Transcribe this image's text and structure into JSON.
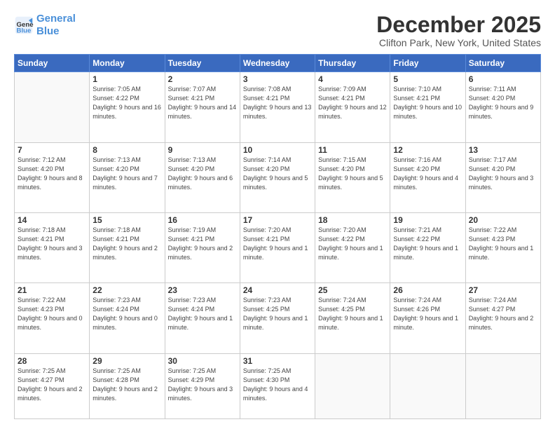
{
  "logo": {
    "line1": "General",
    "line2": "Blue"
  },
  "title": "December 2025",
  "location": "Clifton Park, New York, United States",
  "days_of_week": [
    "Sunday",
    "Monday",
    "Tuesday",
    "Wednesday",
    "Thursday",
    "Friday",
    "Saturday"
  ],
  "weeks": [
    [
      {
        "day": "",
        "sunrise": "",
        "sunset": "",
        "daylight": ""
      },
      {
        "day": "1",
        "sunrise": "Sunrise: 7:05 AM",
        "sunset": "Sunset: 4:22 PM",
        "daylight": "Daylight: 9 hours and 16 minutes."
      },
      {
        "day": "2",
        "sunrise": "Sunrise: 7:07 AM",
        "sunset": "Sunset: 4:21 PM",
        "daylight": "Daylight: 9 hours and 14 minutes."
      },
      {
        "day": "3",
        "sunrise": "Sunrise: 7:08 AM",
        "sunset": "Sunset: 4:21 PM",
        "daylight": "Daylight: 9 hours and 13 minutes."
      },
      {
        "day": "4",
        "sunrise": "Sunrise: 7:09 AM",
        "sunset": "Sunset: 4:21 PM",
        "daylight": "Daylight: 9 hours and 12 minutes."
      },
      {
        "day": "5",
        "sunrise": "Sunrise: 7:10 AM",
        "sunset": "Sunset: 4:21 PM",
        "daylight": "Daylight: 9 hours and 10 minutes."
      },
      {
        "day": "6",
        "sunrise": "Sunrise: 7:11 AM",
        "sunset": "Sunset: 4:20 PM",
        "daylight": "Daylight: 9 hours and 9 minutes."
      }
    ],
    [
      {
        "day": "7",
        "sunrise": "Sunrise: 7:12 AM",
        "sunset": "Sunset: 4:20 PM",
        "daylight": "Daylight: 9 hours and 8 minutes."
      },
      {
        "day": "8",
        "sunrise": "Sunrise: 7:13 AM",
        "sunset": "Sunset: 4:20 PM",
        "daylight": "Daylight: 9 hours and 7 minutes."
      },
      {
        "day": "9",
        "sunrise": "Sunrise: 7:13 AM",
        "sunset": "Sunset: 4:20 PM",
        "daylight": "Daylight: 9 hours and 6 minutes."
      },
      {
        "day": "10",
        "sunrise": "Sunrise: 7:14 AM",
        "sunset": "Sunset: 4:20 PM",
        "daylight": "Daylight: 9 hours and 5 minutes."
      },
      {
        "day": "11",
        "sunrise": "Sunrise: 7:15 AM",
        "sunset": "Sunset: 4:20 PM",
        "daylight": "Daylight: 9 hours and 5 minutes."
      },
      {
        "day": "12",
        "sunrise": "Sunrise: 7:16 AM",
        "sunset": "Sunset: 4:20 PM",
        "daylight": "Daylight: 9 hours and 4 minutes."
      },
      {
        "day": "13",
        "sunrise": "Sunrise: 7:17 AM",
        "sunset": "Sunset: 4:20 PM",
        "daylight": "Daylight: 9 hours and 3 minutes."
      }
    ],
    [
      {
        "day": "14",
        "sunrise": "Sunrise: 7:18 AM",
        "sunset": "Sunset: 4:21 PM",
        "daylight": "Daylight: 9 hours and 3 minutes."
      },
      {
        "day": "15",
        "sunrise": "Sunrise: 7:18 AM",
        "sunset": "Sunset: 4:21 PM",
        "daylight": "Daylight: 9 hours and 2 minutes."
      },
      {
        "day": "16",
        "sunrise": "Sunrise: 7:19 AM",
        "sunset": "Sunset: 4:21 PM",
        "daylight": "Daylight: 9 hours and 2 minutes."
      },
      {
        "day": "17",
        "sunrise": "Sunrise: 7:20 AM",
        "sunset": "Sunset: 4:21 PM",
        "daylight": "Daylight: 9 hours and 1 minute."
      },
      {
        "day": "18",
        "sunrise": "Sunrise: 7:20 AM",
        "sunset": "Sunset: 4:22 PM",
        "daylight": "Daylight: 9 hours and 1 minute."
      },
      {
        "day": "19",
        "sunrise": "Sunrise: 7:21 AM",
        "sunset": "Sunset: 4:22 PM",
        "daylight": "Daylight: 9 hours and 1 minute."
      },
      {
        "day": "20",
        "sunrise": "Sunrise: 7:22 AM",
        "sunset": "Sunset: 4:23 PM",
        "daylight": "Daylight: 9 hours and 1 minute."
      }
    ],
    [
      {
        "day": "21",
        "sunrise": "Sunrise: 7:22 AM",
        "sunset": "Sunset: 4:23 PM",
        "daylight": "Daylight: 9 hours and 0 minutes."
      },
      {
        "day": "22",
        "sunrise": "Sunrise: 7:23 AM",
        "sunset": "Sunset: 4:24 PM",
        "daylight": "Daylight: 9 hours and 0 minutes."
      },
      {
        "day": "23",
        "sunrise": "Sunrise: 7:23 AM",
        "sunset": "Sunset: 4:24 PM",
        "daylight": "Daylight: 9 hours and 1 minute."
      },
      {
        "day": "24",
        "sunrise": "Sunrise: 7:23 AM",
        "sunset": "Sunset: 4:25 PM",
        "daylight": "Daylight: 9 hours and 1 minute."
      },
      {
        "day": "25",
        "sunrise": "Sunrise: 7:24 AM",
        "sunset": "Sunset: 4:25 PM",
        "daylight": "Daylight: 9 hours and 1 minute."
      },
      {
        "day": "26",
        "sunrise": "Sunrise: 7:24 AM",
        "sunset": "Sunset: 4:26 PM",
        "daylight": "Daylight: 9 hours and 1 minute."
      },
      {
        "day": "27",
        "sunrise": "Sunrise: 7:24 AM",
        "sunset": "Sunset: 4:27 PM",
        "daylight": "Daylight: 9 hours and 2 minutes."
      }
    ],
    [
      {
        "day": "28",
        "sunrise": "Sunrise: 7:25 AM",
        "sunset": "Sunset: 4:27 PM",
        "daylight": "Daylight: 9 hours and 2 minutes."
      },
      {
        "day": "29",
        "sunrise": "Sunrise: 7:25 AM",
        "sunset": "Sunset: 4:28 PM",
        "daylight": "Daylight: 9 hours and 2 minutes."
      },
      {
        "day": "30",
        "sunrise": "Sunrise: 7:25 AM",
        "sunset": "Sunset: 4:29 PM",
        "daylight": "Daylight: 9 hours and 3 minutes."
      },
      {
        "day": "31",
        "sunrise": "Sunrise: 7:25 AM",
        "sunset": "Sunset: 4:30 PM",
        "daylight": "Daylight: 9 hours and 4 minutes."
      },
      {
        "day": "",
        "sunrise": "",
        "sunset": "",
        "daylight": ""
      },
      {
        "day": "",
        "sunrise": "",
        "sunset": "",
        "daylight": ""
      },
      {
        "day": "",
        "sunrise": "",
        "sunset": "",
        "daylight": ""
      }
    ]
  ]
}
